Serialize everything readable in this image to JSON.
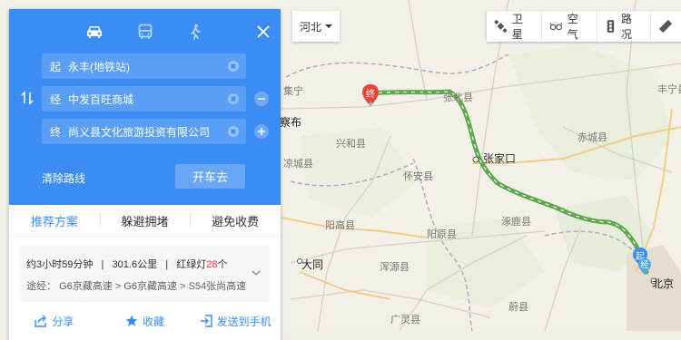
{
  "region_selector": {
    "label": "河北"
  },
  "toolbar": {
    "satellite": "卫星",
    "air": "空气",
    "traffic": "路况"
  },
  "panel": {
    "modes": [
      "drive-icon",
      "bus-icon",
      "walk-icon"
    ],
    "start": {
      "tag": "起",
      "value": "永丰(地铁站)"
    },
    "via": {
      "tag": "经",
      "value": "中发百旺商城"
    },
    "end": {
      "tag": "终",
      "value": "尚义县文化旅游投资有限公司"
    },
    "clear_label": "清除路线",
    "go_label": "开车去",
    "tabs": [
      "推荐方案",
      "躲避拥堵",
      "避免收费"
    ],
    "route": {
      "time": "约3小时59分钟",
      "distance": "301.6公里",
      "lights_prefix": "红绿灯",
      "lights_count": "28",
      "lights_suffix": "个",
      "sep": "|",
      "via_label": "途经：",
      "roads": [
        "G6京藏高速",
        "G6京藏高速",
        "S54张尚高速"
      ]
    },
    "actions": {
      "share": "分享",
      "favorite": "收藏",
      "send": "发送到手机"
    }
  },
  "map": {
    "labels": {
      "chabu": "察布",
      "xinghe": "兴和县",
      "zhangbei": "张北县",
      "zhangjiakou": "张家口",
      "chicheng": "赤城县",
      "huaian": "怀安县",
      "yangyuan": "阳高县",
      "datong": "大同",
      "yanqing": "涿鹿县",
      "beijing": "北京",
      "fengning": "丰宁县",
      "shangyi_marker": "终",
      "start_marker": "起",
      "via_marker": "经",
      "hunyuan": "浑源县",
      "guangling": "广灵县",
      "yangyuan2": "阳原县",
      "yuxian": "蔚县",
      "liangcheng": "凉城县",
      "jining": "集宁"
    },
    "colors": {
      "route": "#5fa84e",
      "marker_end": "#e8463a",
      "marker_start": "#3b8cf3"
    }
  }
}
